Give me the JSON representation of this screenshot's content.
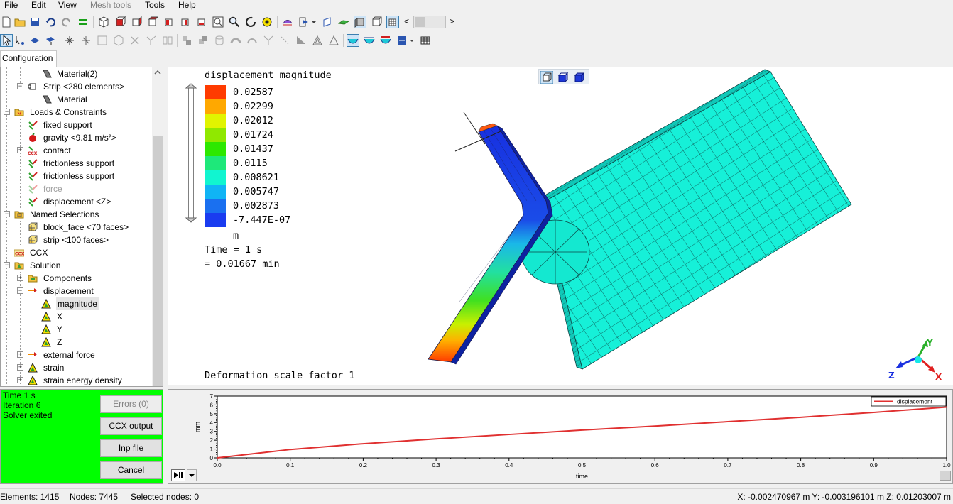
{
  "menubar": {
    "items": [
      {
        "label": "File",
        "enabled": true
      },
      {
        "label": "Edit",
        "enabled": true
      },
      {
        "label": "View",
        "enabled": true
      },
      {
        "label": "Mesh tools",
        "enabled": false
      },
      {
        "label": "Tools",
        "enabled": true
      },
      {
        "label": "Help",
        "enabled": true
      }
    ]
  },
  "toolbar": {
    "nav_left": "<",
    "nav_right": ">"
  },
  "config_tab": {
    "label": "Configuration"
  },
  "tree": {
    "items": [
      {
        "label": "Material(2)",
        "icon": "material-icon"
      },
      {
        "label": "Strip <280 elements>",
        "icon": "part-icon"
      },
      {
        "label": "Material",
        "icon": "material-icon"
      },
      {
        "label": "Loads & Constraints",
        "icon": "folder-icon"
      },
      {
        "label": "fixed support",
        "icon": "support-icon"
      },
      {
        "label": "gravity <9.81 m/s²>",
        "icon": "gravity-icon"
      },
      {
        "label": "contact",
        "icon": "contact-icon"
      },
      {
        "label": "frictionless support",
        "icon": "support-icon"
      },
      {
        "label": "frictionless support",
        "icon": "support-icon"
      },
      {
        "label": "force",
        "icon": "force-icon",
        "disabled": true
      },
      {
        "label": "displacement <Z>",
        "icon": "support-icon"
      },
      {
        "label": "Named Selections",
        "icon": "folder-icon"
      },
      {
        "label": "block_face <70 faces>",
        "icon": "selection-icon"
      },
      {
        "label": "strip <100 faces>",
        "icon": "selection-icon"
      },
      {
        "label": "CCX",
        "icon": "ccx-icon"
      },
      {
        "label": "Solution",
        "icon": "folder-icon"
      },
      {
        "label": "Components",
        "icon": "components-icon"
      },
      {
        "label": "displacement",
        "icon": "arrow-icon"
      },
      {
        "label": "magnitude",
        "icon": "result-icon",
        "selected": true
      },
      {
        "label": "X",
        "icon": "result-icon"
      },
      {
        "label": "Y",
        "icon": "result-icon"
      },
      {
        "label": "Z",
        "icon": "result-icon"
      },
      {
        "label": "external force",
        "icon": "arrow-icon"
      },
      {
        "label": "strain",
        "icon": "result-icon"
      },
      {
        "label": "strain energy density",
        "icon": "result-icon"
      }
    ]
  },
  "viewport": {
    "legend_title": "displacement magnitude",
    "legend": [
      {
        "value": "0.02587",
        "color": "#ff3b00"
      },
      {
        "value": "0.02299",
        "color": "#ffa800"
      },
      {
        "value": "0.02012",
        "color": "#e1f400"
      },
      {
        "value": "0.01724",
        "color": "#90e800"
      },
      {
        "value": "0.01437",
        "color": "#2de800"
      },
      {
        "value": "0.0115",
        "color": "#1ee87a"
      },
      {
        "value": "0.008621",
        "color": "#11f5d0"
      },
      {
        "value": "0.005747",
        "color": "#10b4f5"
      },
      {
        "value": "0.002873",
        "color": "#1a70f0"
      },
      {
        "value": "-7.447E-07",
        "color": "#1a3cf0"
      }
    ],
    "unit": "m",
    "time_line1": "Time = 1 s",
    "time_line2": "= 0.01667 min",
    "scale_text": "Deformation scale factor 1",
    "triad": {
      "x": "X",
      "y": "Y",
      "z": "Z"
    }
  },
  "status_panel": {
    "lines": [
      "Time 1 s",
      "Iteration 6",
      "Solver exited"
    ],
    "buttons": {
      "errors": "Errors (0)",
      "ccx_output": "CCX output",
      "inp_file": "Inp file",
      "cancel": "Cancel"
    },
    "bg_color": "#00ff00"
  },
  "chart_data": {
    "type": "line",
    "xlabel": "time",
    "ylabel": "mm",
    "xlim": [
      0,
      1
    ],
    "ylim": [
      0,
      7
    ],
    "xticks": [
      "0.0",
      "0.1",
      "0.2",
      "0.3",
      "0.4",
      "0.5",
      "0.6",
      "0.7",
      "0.8",
      "0.9",
      "1.0"
    ],
    "yticks": [
      "0",
      "1",
      "2",
      "3",
      "4",
      "5",
      "6",
      "7"
    ],
    "legend_position": "top-right",
    "series": [
      {
        "name": "displacement",
        "color": "#e03030",
        "x": [
          0,
          0.1,
          0.2,
          0.3,
          0.4,
          0.5,
          0.6,
          0.7,
          0.8,
          0.9,
          1.0
        ],
        "y": [
          0,
          0.95,
          1.6,
          2.15,
          2.65,
          3.15,
          3.6,
          4.1,
          4.6,
          5.15,
          5.75
        ]
      }
    ]
  },
  "statusbar": {
    "elements": "Elements: 1415",
    "nodes": "Nodes: 7445",
    "selected": "Selected nodes: 0",
    "coords": "X: -0.002470967 m Y: -0.003196101 m Z: 0.01203007 m"
  }
}
